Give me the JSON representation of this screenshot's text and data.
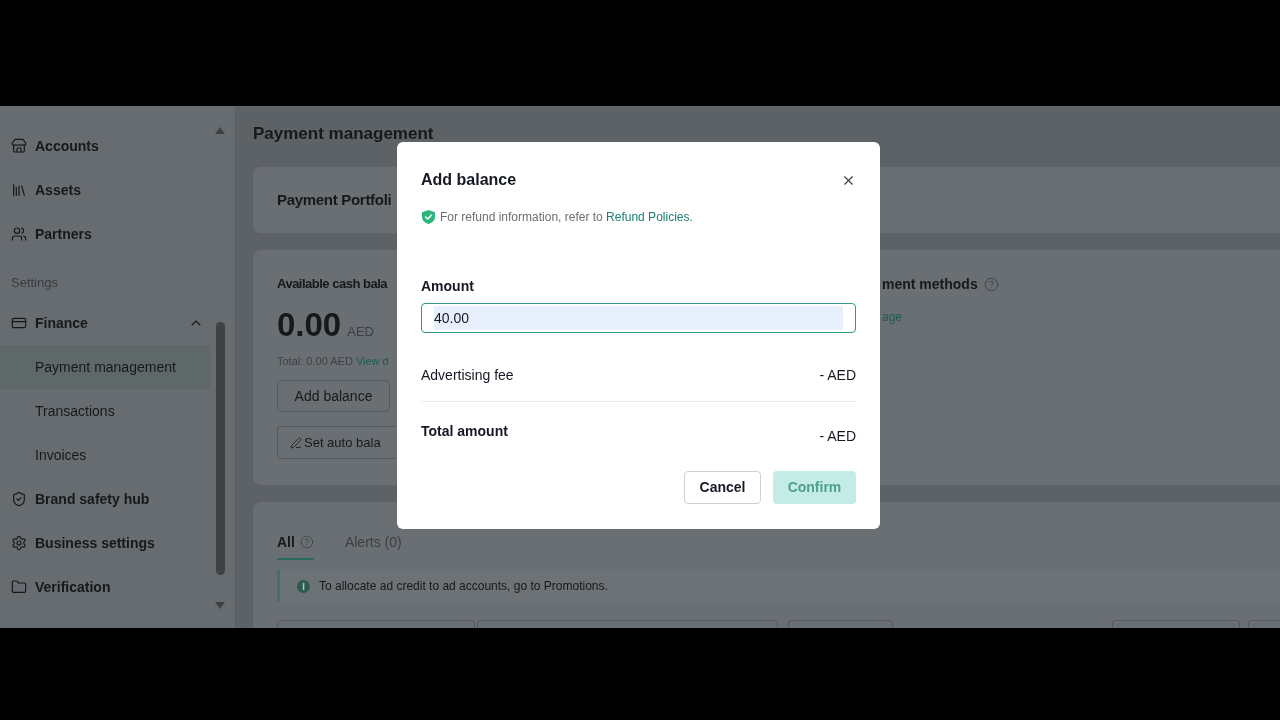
{
  "sidebar": {
    "items": [
      {
        "kind": "link",
        "label": "Accounts"
      },
      {
        "kind": "link",
        "label": "Assets"
      },
      {
        "kind": "link",
        "label": "Partners"
      },
      {
        "kind": "section",
        "label": "Settings"
      },
      {
        "kind": "group",
        "label": "Finance",
        "expanded": true,
        "children": [
          {
            "label": "Payment management",
            "selected": true
          },
          {
            "label": "Transactions",
            "selected": false
          },
          {
            "label": "Invoices",
            "selected": false
          }
        ]
      },
      {
        "kind": "link",
        "label": "Brand safety hub"
      },
      {
        "kind": "link",
        "label": "Business settings"
      },
      {
        "kind": "link",
        "label": "Verification"
      }
    ]
  },
  "page": {
    "title": "Payment management"
  },
  "portfolio_card": {
    "title": "Payment Portfoli"
  },
  "balance_card": {
    "heading": "Available cash bala",
    "amount": "0.00",
    "currency": "AED",
    "total": "Total: 0.00 AED",
    "total_link": "View d",
    "buttons": [
      {
        "kind": "plain",
        "label": "Add balance"
      },
      {
        "kind": "edit",
        "label": "Set auto bala"
      }
    ]
  },
  "payment_methods": {
    "heading": "ment methods",
    "link": "age"
  },
  "tabs": [
    {
      "label": "All",
      "selected": true,
      "help": true
    },
    {
      "label": "Alerts (0)",
      "selected": false,
      "help": false
    }
  ],
  "notice": {
    "text": "To allocate ad credit to ad accounts, go to Promotions."
  },
  "modal": {
    "title": "Add balance",
    "notice": "For refund information, refer to",
    "notice_link": "Refund Policies",
    "notice_end": ".",
    "amount": {
      "label": "Amount",
      "value": "40.00",
      "focused": true
    },
    "rows": [
      {
        "kind": "fee",
        "label": "Advertising fee",
        "value": "- AED"
      },
      {
        "kind": "total",
        "label": "Total amount",
        "value": "- AED"
      }
    ],
    "buttons": [
      {
        "kind": "secondary",
        "label": "Cancel",
        "disabled": false
      },
      {
        "kind": "primary",
        "label": "Confirm",
        "disabled": true
      }
    ]
  }
}
